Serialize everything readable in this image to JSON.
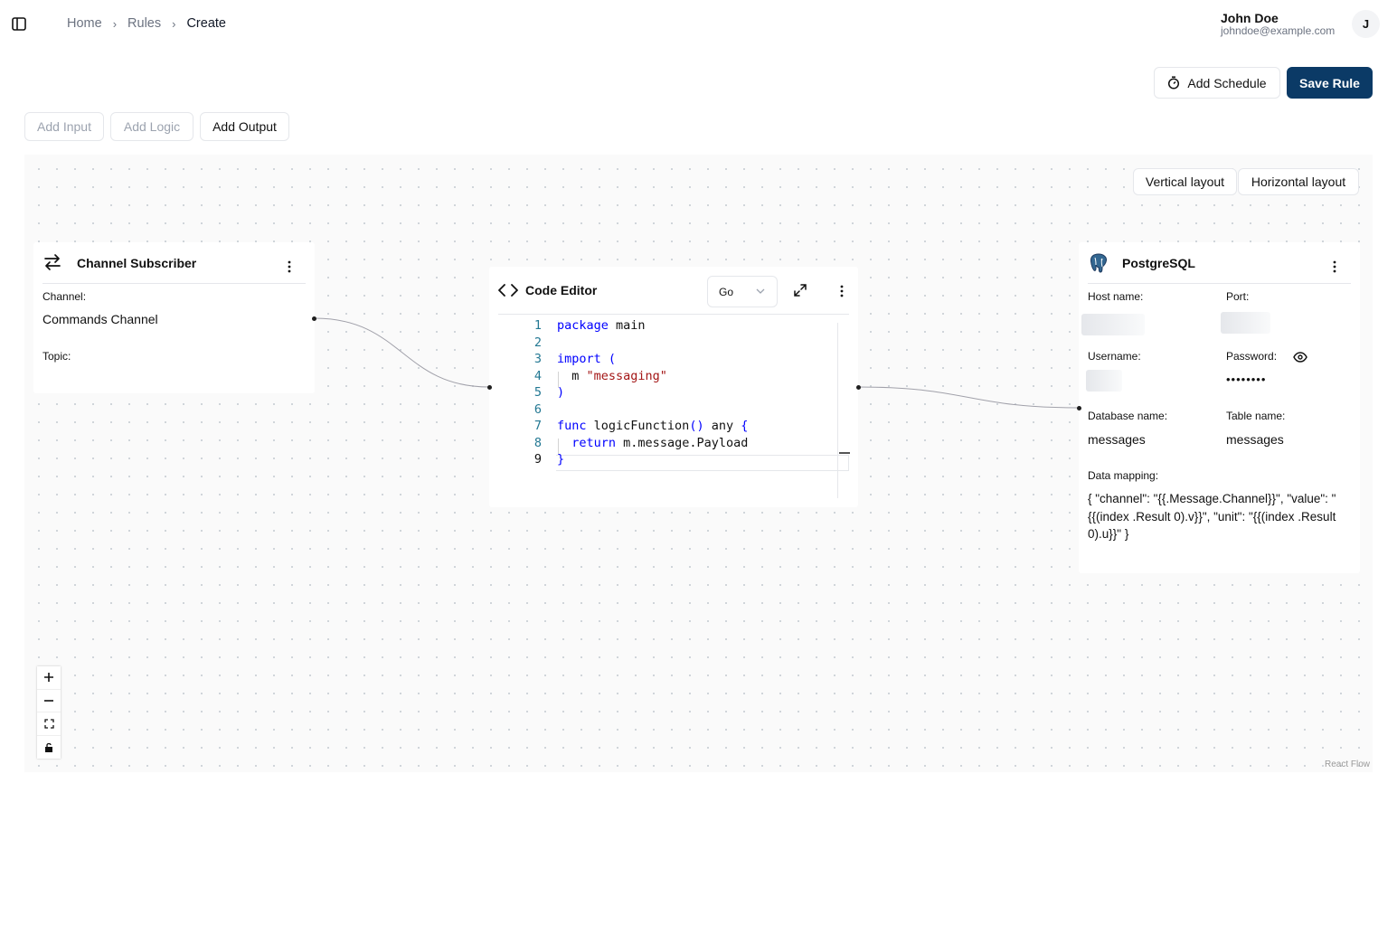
{
  "breadcrumb": [
    "Home",
    "Rules",
    "Create"
  ],
  "user": {
    "name": "John Doe",
    "email": "johndoe@example.com",
    "initial": "J"
  },
  "actions": {
    "add_schedule": "Add Schedule",
    "save_rule": "Save Rule"
  },
  "toolbar": {
    "add_input": "Add Input",
    "add_logic": "Add Logic",
    "add_output": "Add Output"
  },
  "layout": {
    "vertical": "Vertical layout",
    "horizontal": "Horizontal layout"
  },
  "channel_node": {
    "title": "Channel Subscriber",
    "channel_label": "Channel:",
    "channel_value": "Commands Channel",
    "topic_label": "Topic:",
    "icon": "arrows-right-left-icon"
  },
  "code_node": {
    "title": "Code Editor",
    "language": "Go",
    "icon": "code-icon",
    "active_line": 9
  },
  "postgres_node": {
    "title": "PostgreSQL",
    "icon": "postgresql-elephant-icon",
    "host_label": "Host name:",
    "port_label": "Port:",
    "username_label": "Username:",
    "password_label": "Password:",
    "password_mask": "••••••••",
    "database_label": "Database name:",
    "database_value": "messages",
    "table_label": "Table name:",
    "table_value": "messages",
    "mapping_label": "Data mapping:",
    "mapping_value": "{ \"channel\": \"{{.Message.Channel}}\", \"value\": \"{{(index .Result 0).v}}\", \"unit\": \"{{(index .Result 0).u}}\" }"
  },
  "flow": {
    "attribution": "React Flow"
  },
  "colors": {
    "primary": "#0b3a66",
    "keyword": "#0000ff",
    "string": "#a31515",
    "line_number": "#237893"
  }
}
